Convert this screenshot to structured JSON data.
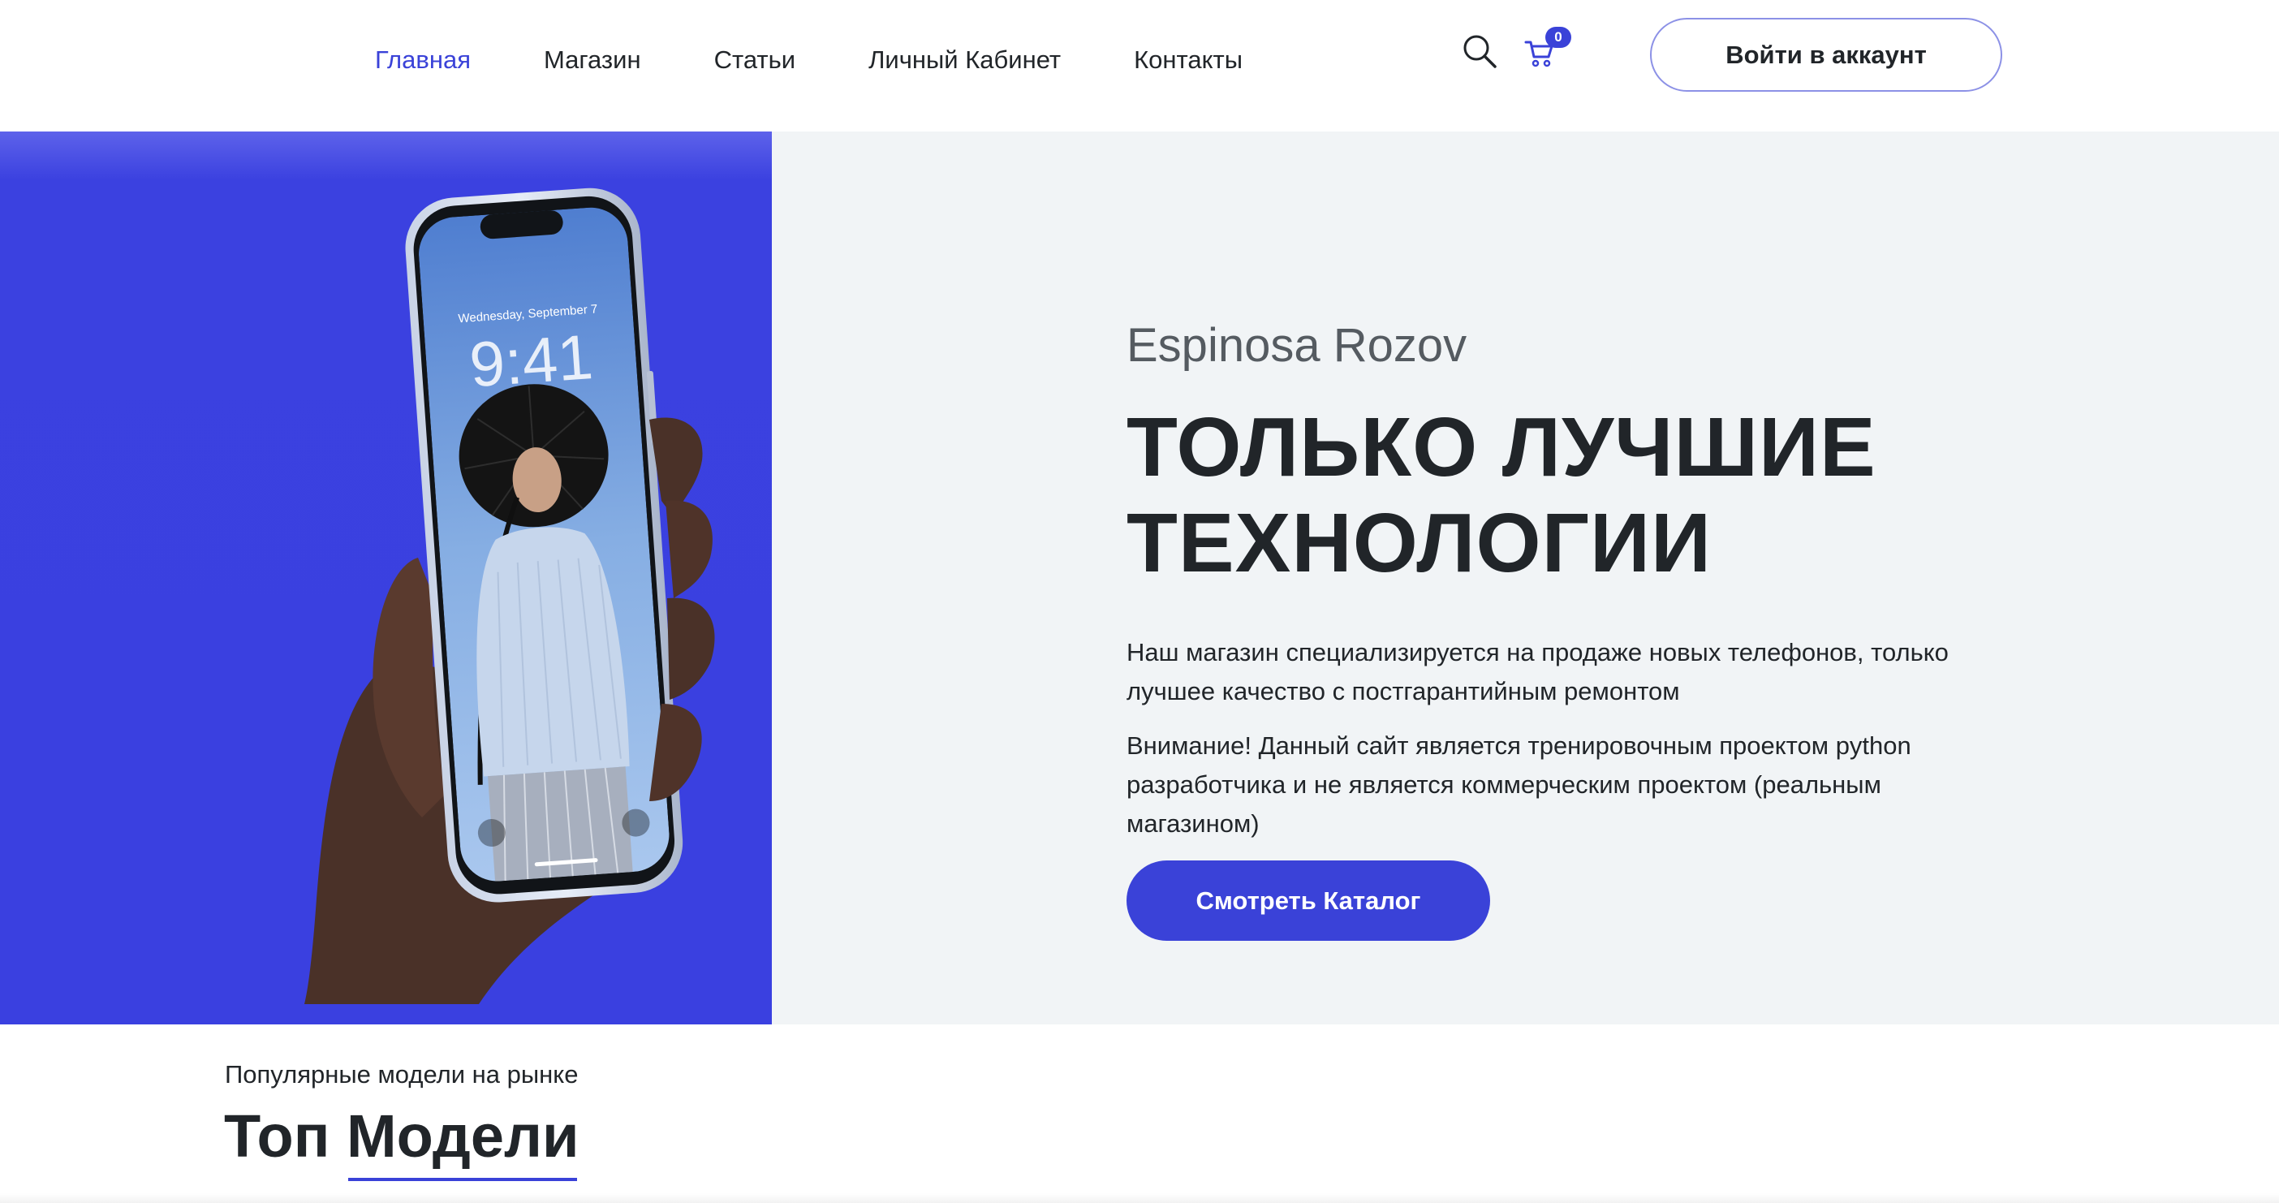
{
  "header": {
    "nav": [
      {
        "label": "Главная",
        "active": true
      },
      {
        "label": "Магазин",
        "active": false
      },
      {
        "label": "Статьи",
        "active": false
      },
      {
        "label": "Личный Кабинет",
        "active": false
      },
      {
        "label": "Контакты",
        "active": false
      }
    ],
    "search_icon": "search-icon",
    "cart_icon": "shopping-cart-icon",
    "cart_count": "0",
    "login_label": "Войти в аккаунт"
  },
  "hero": {
    "brand": "Espinosa Rozov",
    "title_line1": "ТОЛЬКО ЛУЧШИЕ",
    "title_line2": "ТЕХНОЛОГИИ",
    "paragraph1": "Наш магазин специализируется на продаже новых телефонов, только лучшее качество с постгарантийным ремонтом",
    "paragraph2": "Внимание! Данный сайт является тренировочным проектом python разработчика и не является коммерческим проектом (реальным магазином)",
    "catalog_button": "Смотреть Каталог",
    "phone_date": "Wednesday, September 7",
    "phone_time": "9:41"
  },
  "top_models": {
    "subtitle": "Популярные модели на рынке",
    "title": "Топ Модели"
  },
  "colors": {
    "accent": "#3a42d8",
    "hero_panel": "#3a40e0",
    "hero_bg": "#f1f4f6",
    "text": "#212529"
  }
}
